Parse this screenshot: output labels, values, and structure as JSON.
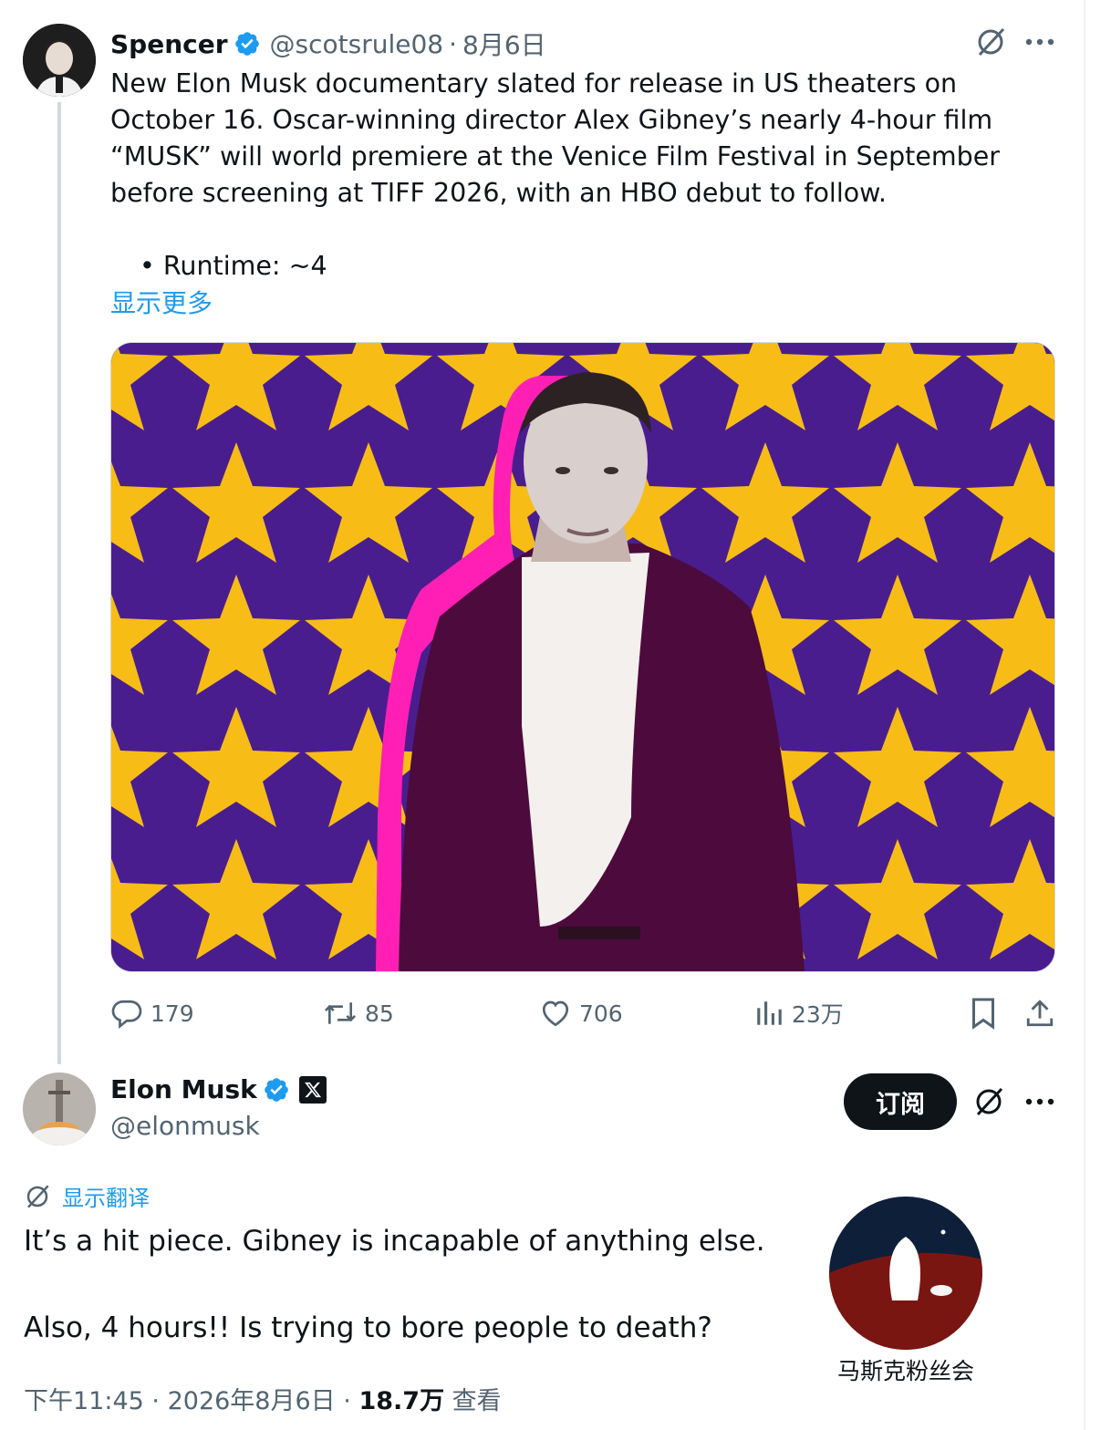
{
  "original_tweet": {
    "author_name": "Spencer",
    "handle": "@scotsrule08",
    "separator": "·",
    "date": "8月6日",
    "text_paragraphs": [
      "New Elon Musk documentary slated for release in US theaters on October 16. Oscar-winning director Alex Gibney’s nearly 4-hour film “MUSK” will world premiere at the Venice Film Festival in September before screening at TIFF 2026, with an HBO debut to follow.",
      "• Runtime: ~4"
    ],
    "show_more": "显示更多",
    "media_icon": "star-pattern-portrait-image",
    "actions": {
      "replies": "179",
      "reposts": "85",
      "likes": "706",
      "views": "23万"
    }
  },
  "reply_tweet": {
    "author_name": "Elon Musk",
    "handle": "@elonmusk",
    "subscribe_label": "订阅",
    "translate_label": "显示翻译",
    "text_paragraphs": [
      "It’s a hit piece. Gibney is incapable of anything else.",
      "Also, 4 hours!! Is trying to bore people to death?"
    ],
    "meta": {
      "time": "下午11:45",
      "separator": "·",
      "date": "2026年8月6日",
      "separator2": "·",
      "views": "18.7万",
      "views_suffix": "查看"
    }
  },
  "watermark": {
    "label": "马斯克粉丝会"
  },
  "colors": {
    "accent": "#1d9bf0",
    "text": "#0f1419",
    "secondary": "#536471",
    "star_yellow": "#f7bd16",
    "star_background": "#4a1d8f",
    "neon_pink": "#ff1fb4"
  }
}
